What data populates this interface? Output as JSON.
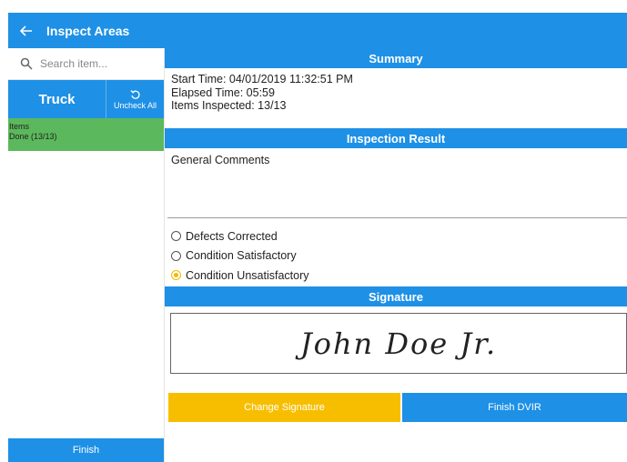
{
  "appbar": {
    "back_icon": "arrow-left-icon",
    "title": "Inspect Areas"
  },
  "sidebar": {
    "search_placeholder": "Search item...",
    "search_icon": "search-icon",
    "tab_truck": "Truck",
    "uncheck_all": "Uncheck All",
    "uncheck_icon": "undo-icon",
    "item": {
      "title": "Items",
      "status": "Done (13/13)",
      "color": "#5cb85c"
    },
    "finish": "Finish"
  },
  "summary": {
    "header": "Summary",
    "start_time": "Start Time: 04/01/2019 11:32:51 PM",
    "elapsed": "Elapsed Time: 05:59",
    "inspected": "Items Inspected: 13/13"
  },
  "inspection": {
    "header": "Inspection Result",
    "comments_label": "General Comments",
    "options": [
      {
        "label": "Defects Corrected",
        "selected": false
      },
      {
        "label": "Condition Satisfactory",
        "selected": false
      },
      {
        "label": "Condition Unsatisfactory",
        "selected": true
      }
    ]
  },
  "signature": {
    "header": "Signature",
    "text": "John Doe Jr."
  },
  "buttons": {
    "change_signature": "Change Signature",
    "finish_dvir": "Finish DVIR"
  },
  "colors": {
    "primary": "#1e90e6",
    "accent": "#f7be00",
    "done": "#5cb85c"
  }
}
